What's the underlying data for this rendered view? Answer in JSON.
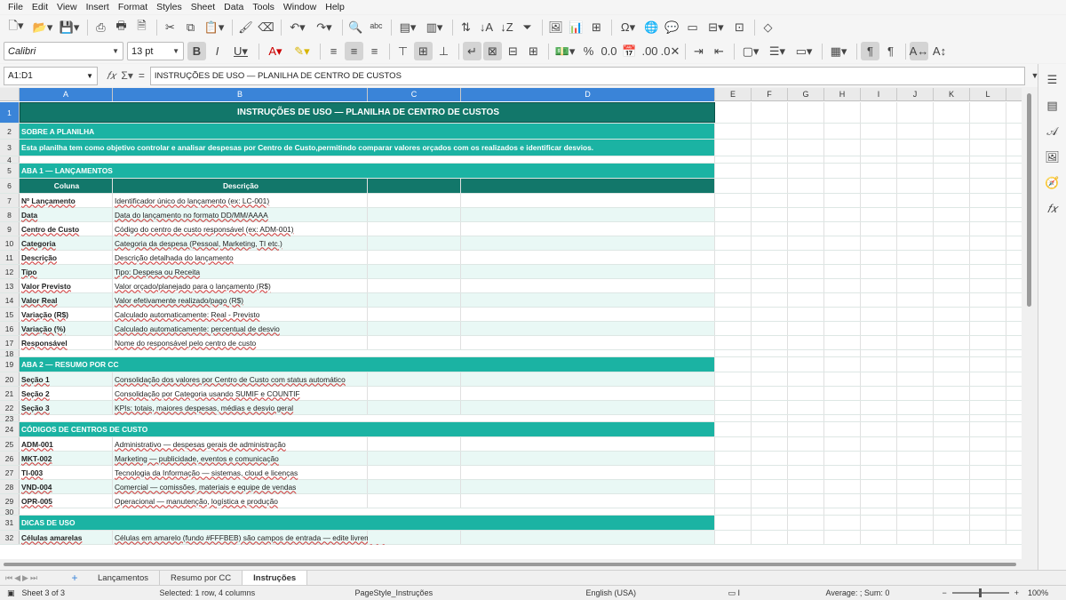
{
  "menu": [
    "File",
    "Edit",
    "View",
    "Insert",
    "Format",
    "Styles",
    "Sheet",
    "Data",
    "Tools",
    "Window",
    "Help"
  ],
  "toolbar": {
    "font_name": "Calibri",
    "font_size": "13 pt"
  },
  "formula_bar": {
    "name_box": "A1:D1",
    "formula": "INSTRUÇÕES DE USO — PLANILHA DE CENTRO DE CUSTOS"
  },
  "columns": [
    "A",
    "B",
    "C",
    "D",
    "E",
    "F",
    "G",
    "H",
    "I",
    "J",
    "K",
    "L"
  ],
  "rows": [
    {
      "n": "1",
      "type": "banner",
      "text": "INSTRUÇÕES DE USO — PLANILHA DE CENTRO DE CUSTOS"
    },
    {
      "n": "2",
      "type": "section",
      "text": "SOBRE A PLANILHA"
    },
    {
      "n": "3",
      "type": "section",
      "text": "Esta planilha tem como objetivo controlar e analisar despesas por Centro de Custo,permitindo comparar valores orçados com os realizados e identificar desvios."
    },
    {
      "n": "4",
      "type": "blank"
    },
    {
      "n": "5",
      "type": "section",
      "text": "ABA 1 — LANÇAMENTOS"
    },
    {
      "n": "6",
      "type": "header",
      "a": "Coluna",
      "b": "Descrição"
    },
    {
      "n": "7",
      "type": "data",
      "a": "Nº Lançamento",
      "b": "Identificador único do lançamento (ex: LC-001)"
    },
    {
      "n": "8",
      "type": "data",
      "a": "Data",
      "b": "Data do lançamento no formato DD/MM/AAAA"
    },
    {
      "n": "9",
      "type": "data",
      "a": "Centro de Custo",
      "b": "Código do centro de custo responsável (ex: ADM-001)"
    },
    {
      "n": "10",
      "type": "data",
      "a": "Categoria",
      "b": "Categoria da despesa (Pessoal, Marketing, TI etc.)"
    },
    {
      "n": "11",
      "type": "data",
      "a": "Descrição",
      "b": "Descrição detalhada do lançamento"
    },
    {
      "n": "12",
      "type": "data",
      "a": "Tipo",
      "b": "Tipo: Despesa ou Receita"
    },
    {
      "n": "13",
      "type": "data",
      "a": "Valor Previsto",
      "b": "Valor orçado/planejado para o lançamento (R$)"
    },
    {
      "n": "14",
      "type": "data",
      "a": "Valor Real",
      "b": "Valor efetivamente realizado/pago (R$)"
    },
    {
      "n": "15",
      "type": "data",
      "a": "Variação (R$)",
      "b": "Calculado automaticamente: Real - Previsto"
    },
    {
      "n": "16",
      "type": "data",
      "a": "Variação (%)",
      "b": "Calculado automaticamente: percentual de desvio"
    },
    {
      "n": "17",
      "type": "data",
      "a": "Responsável",
      "b": "Nome do responsável pelo centro de custo"
    },
    {
      "n": "18",
      "type": "blank"
    },
    {
      "n": "19",
      "type": "section",
      "text": "ABA 2 — RESUMO POR CC"
    },
    {
      "n": "20",
      "type": "data",
      "a": "Seção 1",
      "b": "Consolidação dos valores por Centro de Custo com status automático"
    },
    {
      "n": "21",
      "type": "data",
      "a": "Seção 2",
      "b": "Consolidação por Categoria usando SUMIF e COUNTIF"
    },
    {
      "n": "22",
      "type": "data",
      "a": "Seção 3",
      "b": "KPIs: totais, maiores despesas, médias e desvio geral"
    },
    {
      "n": "23",
      "type": "blank"
    },
    {
      "n": "24",
      "type": "section",
      "text": "CÓDIGOS DE CENTROS DE CUSTO"
    },
    {
      "n": "25",
      "type": "data",
      "a": "ADM-001",
      "b": "Administrativo — despesas gerais de administração"
    },
    {
      "n": "26",
      "type": "data",
      "a": "MKT-002",
      "b": "Marketing — publicidade, eventos e comunicação"
    },
    {
      "n": "27",
      "type": "data",
      "a": "TI-003",
      "b": "Tecnologia da Informação — sistemas, cloud e licenças"
    },
    {
      "n": "28",
      "type": "data",
      "a": "VND-004",
      "b": "Comercial — comissões, materiais e equipe de vendas"
    },
    {
      "n": "29",
      "type": "data",
      "a": "OPR-005",
      "b": "Operacional — manutenção, logística e produção"
    },
    {
      "n": "30",
      "type": "blank"
    },
    {
      "n": "31",
      "type": "section",
      "text": "DICAS DE USO"
    },
    {
      "n": "32",
      "type": "data",
      "a": "Células amarelas",
      "b": "Células em amarelo (fundo #FFFBEB) são campos de entrada — edite livremente"
    }
  ],
  "tabs": [
    "Lançamentos",
    "Resumo por CC",
    "Instruções"
  ],
  "active_tab": "Instruções",
  "status": {
    "sheet": "Sheet 3 of 3",
    "selection": "Selected: 1 row, 4 columns",
    "page_style": "PageStyle_Instruções",
    "language": "English (USA)",
    "sum": "Average: ; Sum: 0",
    "zoom": "100%"
  },
  "colors": {
    "banner": "#12776a",
    "section": "#1bb3a3",
    "alt_row": "#e9f8f5",
    "selection": "#3a84d8"
  }
}
